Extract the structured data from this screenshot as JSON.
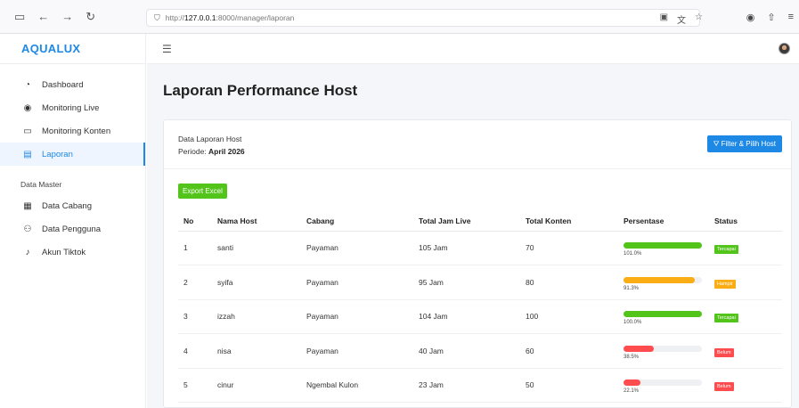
{
  "browser": {
    "url_prefix": "http://",
    "url_host": "127.0.0.1",
    "url_rest": ":8000/manager/laporan"
  },
  "sidebar": {
    "brand": "AQUALUX",
    "items": [
      {
        "label": "Dashboard",
        "icon": "gauge-icon"
      },
      {
        "label": "Monitoring Live",
        "icon": "eye-icon"
      },
      {
        "label": "Monitoring Konten",
        "icon": "video-icon"
      },
      {
        "label": "Laporan",
        "icon": "file-icon"
      }
    ],
    "section_title": "Data Master",
    "master_items": [
      {
        "label": "Data Cabang",
        "icon": "building-icon"
      },
      {
        "label": "Data Pengguna",
        "icon": "users-icon"
      },
      {
        "label": "Akun Tiktok",
        "icon": "tiktok-icon"
      }
    ]
  },
  "page": {
    "title": "Laporan Performance Host",
    "card_title": "Data Laporan Host",
    "periode_label": "Periode: ",
    "periode_value": "April 2026",
    "filter_label": "⛛ Filter & Pilih Host",
    "export_label": "Export Excel"
  },
  "table": {
    "headers": [
      "No",
      "Nama Host",
      "Cabang",
      "Total Jam Live",
      "Total Konten",
      "Persentase",
      "Status"
    ],
    "rows": [
      {
        "no": "1",
        "nama": "santi",
        "cabang": "Payaman",
        "jam": "105 Jam",
        "konten": "70",
        "pct_label": "101.0%",
        "pct": 1.0,
        "status": "Tercapai"
      },
      {
        "no": "2",
        "nama": "syifa",
        "cabang": "Payaman",
        "jam": "95 Jam",
        "konten": "80",
        "pct_label": "91.3%",
        "pct": 0.913,
        "status": "Hampir"
      },
      {
        "no": "3",
        "nama": "izzah",
        "cabang": "Payaman",
        "jam": "104 Jam",
        "konten": "100",
        "pct_label": "100.0%",
        "pct": 1.0,
        "status": "Tercapai"
      },
      {
        "no": "4",
        "nama": "nisa",
        "cabang": "Payaman",
        "jam": "40 Jam",
        "konten": "60",
        "pct_label": "38.5%",
        "pct": 0.385,
        "status": "Belum"
      },
      {
        "no": "5",
        "nama": "cinur",
        "cabang": "Ngembal Kulon",
        "jam": "23 Jam",
        "konten": "50",
        "pct_label": "22.1%",
        "pct": 0.221,
        "status": "Belum"
      }
    ]
  },
  "colors": {
    "accent": "#1e88e5",
    "success": "#52c41a",
    "warning": "#faad14",
    "danger": "#ff4d4f"
  }
}
